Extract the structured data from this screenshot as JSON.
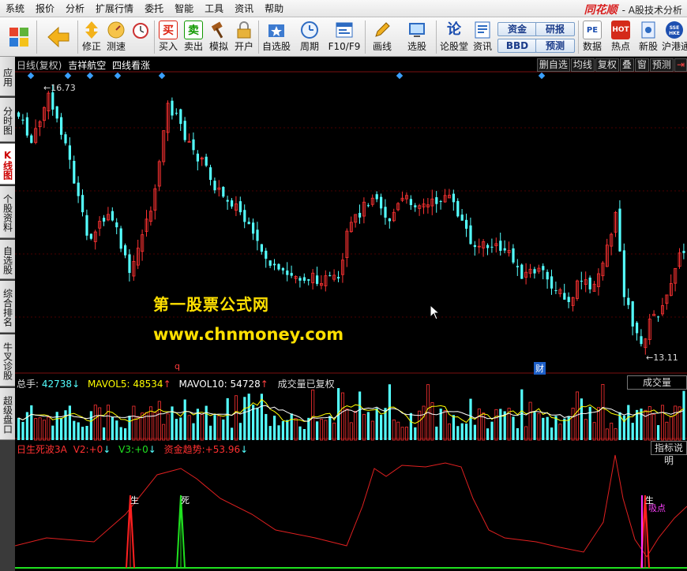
{
  "menubar": {
    "items": [
      "系统",
      "报价",
      "分析",
      "扩展行情",
      "委托",
      "智能",
      "工具",
      "资讯",
      "帮助"
    ],
    "brand_logo": "同花顺",
    "brand_title": "- A股技术分析"
  },
  "toolbar": {
    "buttons": [
      {
        "label": "修正",
        "icon": "up-down-arrows-icon"
      },
      {
        "label": "测速",
        "icon": "speed-icon"
      },
      {
        "label": "买入",
        "icon": "buy-icon",
        "glyph": "买"
      },
      {
        "label": "卖出",
        "icon": "sell-icon",
        "glyph": "卖"
      },
      {
        "label": "模拟",
        "icon": "hammer-icon"
      },
      {
        "label": "开户",
        "icon": "lock-icon"
      },
      {
        "label": "自选股",
        "icon": "star-folder-icon"
      },
      {
        "label": "周期",
        "icon": "clock-icon"
      },
      {
        "label": "F10/F9",
        "icon": "f10-icon"
      },
      {
        "label": "画线",
        "icon": "pencil-icon"
      },
      {
        "label": "选股",
        "icon": "screen-icon"
      },
      {
        "label": "论股堂",
        "icon": "discussion-icon",
        "glyph": "论"
      },
      {
        "label": "资讯",
        "icon": "news-icon"
      },
      {
        "label": "数据",
        "icon": "pe-data-icon",
        "glyph": "PE"
      },
      {
        "label": "热点",
        "icon": "hot-icon",
        "glyph": "HOT"
      },
      {
        "label": "新股",
        "icon": "ipo-icon"
      },
      {
        "label": "沪港通",
        "icon": "sse-hkex-icon"
      }
    ],
    "text_buttons": [
      "资金",
      "研报",
      "BBD",
      "预测"
    ]
  },
  "left_tabs": [
    "应用",
    "分时图",
    "K线图",
    "个股资料",
    "自选股",
    "综合排名",
    "牛叉诊股",
    "超级盘口"
  ],
  "chart": {
    "title_parts": [
      "日线(复权)",
      "吉祥航空",
      "四线看涨"
    ],
    "buttons": [
      "删自选",
      "均线",
      "复权",
      "叠",
      "窗",
      "预测",
      "⇥"
    ],
    "max_price_label": "16.73",
    "min_price_label": "13.11",
    "watermark_line1": "第一股票公式网",
    "watermark_line2": "www.chnmoney.com",
    "marker_q": "q",
    "marker_cai": "财"
  },
  "volume_panel": {
    "total_label": "总手:",
    "total_value": "42738",
    "total_arrow": "↓",
    "mavol5_label": "MAVOL5:",
    "mavol5_value": "48534",
    "mavol5_arrow": "↑",
    "mavol10_label": "MAVOL10:",
    "mavol10_value": "54728",
    "mavol10_arrow": "↑",
    "note": "成交量已复权",
    "box_label": "成交量"
  },
  "indicator_panel": {
    "name": "日生死波3A",
    "v2_label": "V2:",
    "v2_value": "+0",
    "v2_arrow": "↓",
    "v3_label": "V3:",
    "v3_value": "+0",
    "v3_arrow": "↓",
    "trend_label": "资金趋势:",
    "trend_value": "+53.96",
    "trend_arrow": "↓",
    "box_label": "指标说明",
    "signal_sheng": "生",
    "signal_si": "死",
    "signal_sheng2": "生",
    "signal_xidian": "吸点"
  },
  "colors": {
    "up": "#ff3232",
    "down": "#54ffff",
    "ma_white": "#ffffff",
    "ma_yellow": "#ffff00",
    "indicator_line": "#e02020",
    "signal_red": "#ff2020",
    "signal_green": "#20e020",
    "signal_magenta": "#ff30ff",
    "watermark": "#ffe000"
  }
}
